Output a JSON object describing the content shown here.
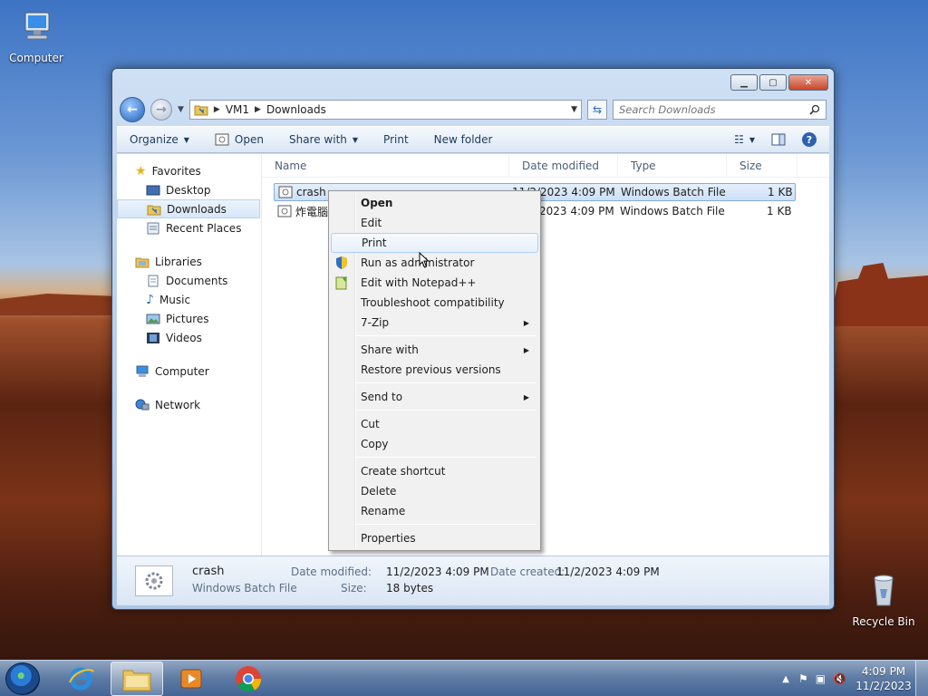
{
  "desktop": {
    "icons": [
      {
        "label": "Computer"
      },
      {
        "label": "Recycle Bin"
      }
    ]
  },
  "window": {
    "address": {
      "segments": [
        "VM1",
        "Downloads"
      ]
    },
    "search_placeholder": "Search Downloads",
    "toolbar": {
      "organize": "Organize",
      "open": "Open",
      "share_with": "Share with",
      "print": "Print",
      "new_folder": "New folder"
    },
    "nav": {
      "favorites": {
        "label": "Favorites",
        "items": [
          "Desktop",
          "Downloads",
          "Recent Places"
        ]
      },
      "libraries": {
        "label": "Libraries",
        "items": [
          "Documents",
          "Music",
          "Pictures",
          "Videos"
        ]
      },
      "computer": "Computer",
      "network": "Network"
    },
    "columns": [
      "Name",
      "Date modified",
      "Type",
      "Size"
    ],
    "files": [
      {
        "name": "crash",
        "date": "11/2/2023 4:09 PM",
        "type": "Windows Batch File",
        "size": "1 KB"
      },
      {
        "name": "炸電腦",
        "date": "11/2/2023 4:09 PM",
        "type": "Windows Batch File",
        "size": "1 KB"
      }
    ],
    "details": {
      "name": "crash",
      "type": "Windows Batch File",
      "date_modified_label": "Date modified:",
      "date_modified": "11/2/2023 4:09 PM",
      "date_created_label": "Date created:",
      "date_created": "11/2/2023 4:09 PM",
      "size_label": "Size:",
      "size": "18 bytes"
    }
  },
  "context_menu": {
    "items": [
      {
        "label": "Open"
      },
      {
        "label": "Edit"
      },
      {
        "label": "Print"
      },
      {
        "label": "Run as administrator"
      },
      {
        "label": "Edit with Notepad++"
      },
      {
        "label": "Troubleshoot compatibility"
      },
      {
        "label": "7-Zip"
      },
      {
        "label": "Share with"
      },
      {
        "label": "Restore previous versions"
      },
      {
        "label": "Send to"
      },
      {
        "label": "Cut"
      },
      {
        "label": "Copy"
      },
      {
        "label": "Create shortcut"
      },
      {
        "label": "Delete"
      },
      {
        "label": "Rename"
      },
      {
        "label": "Properties"
      }
    ],
    "hovered": "Print"
  },
  "taskbar": {
    "time": "4:09 PM",
    "date": "11/2/2023"
  }
}
